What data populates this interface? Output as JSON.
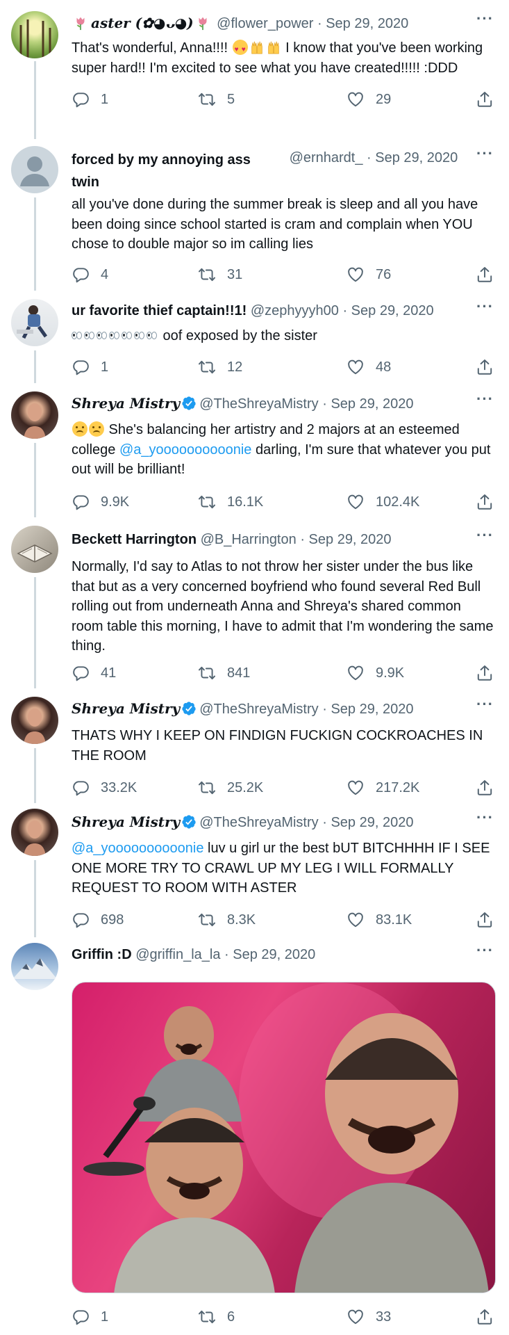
{
  "colors": {
    "link": "#1d9bf0",
    "muted": "#536471",
    "text": "#0f1419",
    "rail": "#cfd9de"
  },
  "tweets": [
    {
      "name": "aster (✿◕ᴗ◕)",
      "name_prefix_icon": "tulip-icon",
      "name_suffix_icon": "tulip-icon",
      "handle": "@flower_power",
      "date": "Sep 29, 2020",
      "text_1": "That's wonderful, Anna!!!! ",
      "text_2": " I know that you've been working super hard!! I'm excited to see what you have created!!!!! :DDD",
      "emoji": [
        "heart-eyes-emoji",
        "raised-hands-emoji",
        "raised-hands-emoji"
      ],
      "replies": "1",
      "retweets": "5",
      "likes": "29"
    },
    {
      "name": "forced by my annoying ass twin",
      "handle": "@ernhardt_",
      "date": "Sep 29, 2020",
      "text": "all you've done during the summer break is sleep and all you have been doing since school started is cram and complain when YOU chose to double major so im calling lies",
      "replies": "4",
      "retweets": "31",
      "likes": "76"
    },
    {
      "name": "ur favorite thief captain!!1!",
      "handle": "@zephyyyh00",
      "date": "Sep 29, 2020",
      "emoji": "eyes-emoji",
      "emoji_count": 7,
      "text": " oof exposed by the sister",
      "replies": "1",
      "retweets": "12",
      "likes": "48"
    },
    {
      "name": "Shreya Mistry",
      "handle": "@TheShreyaMistry",
      "date": "Sep 29, 2020",
      "verified": true,
      "emoji": [
        "pleading-face-emoji",
        "pleading-face-emoji"
      ],
      "text_1": " She's balancing her artistry and 2 majors at an esteemed college ",
      "mention": "@a_yoooooooooonie",
      "text_2": " darling, I'm sure that whatever you put out will be brilliant!",
      "replies": "9.9K",
      "retweets": "16.1K",
      "likes": "102.4K"
    },
    {
      "name": "Beckett Harrington",
      "handle": "@B_Harrington",
      "date": "Sep 29, 2020",
      "text": "Normally, I'd say to Atlas to not throw her sister under the bus like that but as a very concerned boyfriend who found several Red Bull rolling out from underneath Anna and Shreya's shared common room table this morning, I have to admit that I'm wondering the same thing.",
      "replies": "41",
      "retweets": "841",
      "likes": "9.9K"
    },
    {
      "name": "Shreya Mistry",
      "handle": "@TheShreyaMistry",
      "date": "Sep 29, 2020",
      "verified": true,
      "text": "THATS WHY I KEEP ON FINDIGN FUCKIGN COCKROACHES IN THE ROOM",
      "replies": "33.2K",
      "retweets": "25.2K",
      "likes": "217.2K"
    },
    {
      "name": "Shreya Mistry",
      "handle": "@TheShreyaMistry",
      "date": "Sep 29, 2020",
      "verified": true,
      "mention": "@a_yoooooooooonie",
      "text": " luv u girl ur the best bUT BITCHHHH IF I SEE ONE MORE TRY TO CRAWL UP MY LEG I WILL FORMALLY REQUEST TO ROOM WITH ASTER",
      "replies": "698",
      "retweets": "8.3K",
      "likes": "83.1K"
    },
    {
      "name": "Griffin :D",
      "handle": "@griffin_la_la",
      "date": "Sep 29, 2020",
      "media": "laughing-man-meme-image",
      "replies": "1",
      "retweets": "6",
      "likes": "33"
    }
  ],
  "separator": "·",
  "more_label": "···"
}
